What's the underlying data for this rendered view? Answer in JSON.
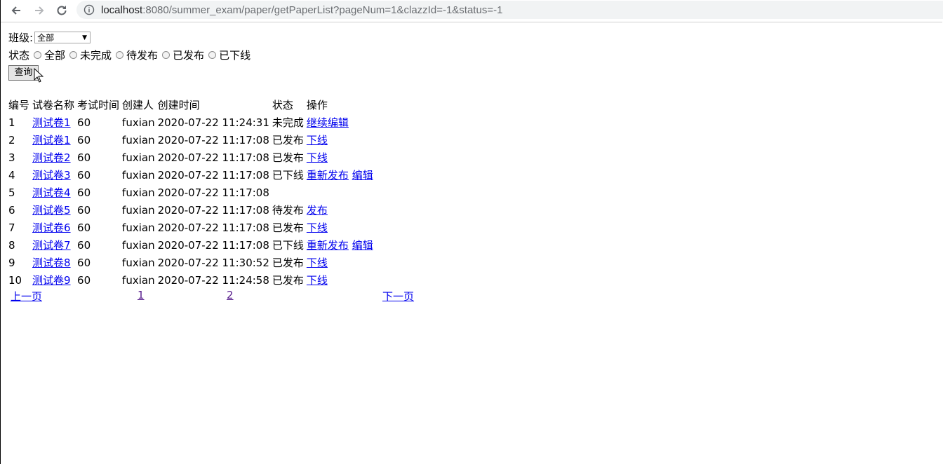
{
  "browser": {
    "url_host": "localhost",
    "url_path": ":8080/summer_exam/paper/getPaperList?pageNum=1&clazzId=-1&status=-1"
  },
  "filters": {
    "clazz_label": "班级:",
    "clazz_selected": "全部",
    "status_label": "状态",
    "status_options": [
      "全部",
      "未完成",
      "待发布",
      "已发布",
      "已下线"
    ],
    "query_button": "查询"
  },
  "table": {
    "headers": [
      "编号",
      "试卷名称",
      "考试时间",
      "创建人",
      "创建时间",
      "状态",
      "操作"
    ],
    "rows": [
      {
        "id": "1",
        "name": "测试卷1",
        "duration": "60",
        "creator": "fuxian",
        "created": "2020-07-22 11:24:31",
        "status": "未完成",
        "actions": [
          "继续编辑"
        ]
      },
      {
        "id": "2",
        "name": "测试卷1",
        "duration": "60",
        "creator": "fuxian",
        "created": "2020-07-22 11:17:08",
        "status": "已发布",
        "actions": [
          "下线"
        ]
      },
      {
        "id": "3",
        "name": "测试卷2",
        "duration": "60",
        "creator": "fuxian",
        "created": "2020-07-22 11:17:08",
        "status": "已发布",
        "actions": [
          "下线"
        ]
      },
      {
        "id": "4",
        "name": "测试卷3",
        "duration": "60",
        "creator": "fuxian",
        "created": "2020-07-22 11:17:08",
        "status": "已下线",
        "actions": [
          "重新发布",
          "编辑"
        ]
      },
      {
        "id": "5",
        "name": "测试卷4",
        "duration": "60",
        "creator": "fuxian",
        "created": "2020-07-22 11:17:08",
        "status": "",
        "actions": []
      },
      {
        "id": "6",
        "name": "测试卷5",
        "duration": "60",
        "creator": "fuxian",
        "created": "2020-07-22 11:17:08",
        "status": "待发布",
        "actions": [
          "发布"
        ]
      },
      {
        "id": "7",
        "name": "测试卷6",
        "duration": "60",
        "creator": "fuxian",
        "created": "2020-07-22 11:17:08",
        "status": "已发布",
        "actions": [
          "下线"
        ]
      },
      {
        "id": "8",
        "name": "测试卷7",
        "duration": "60",
        "creator": "fuxian",
        "created": "2020-07-22 11:17:08",
        "status": "已下线",
        "actions": [
          "重新发布",
          "编辑"
        ]
      },
      {
        "id": "9",
        "name": "测试卷8",
        "duration": "60",
        "creator": "fuxian",
        "created": "2020-07-22 11:30:52",
        "status": "已发布",
        "actions": [
          "下线"
        ]
      },
      {
        "id": "10",
        "name": "测试卷9",
        "duration": "60",
        "creator": "fuxian",
        "created": "2020-07-22 11:24:58",
        "status": "已发布",
        "actions": [
          "下线"
        ]
      }
    ]
  },
  "pager": {
    "prev": "上一页",
    "pages": [
      "1",
      "2"
    ],
    "next": "下一页"
  }
}
